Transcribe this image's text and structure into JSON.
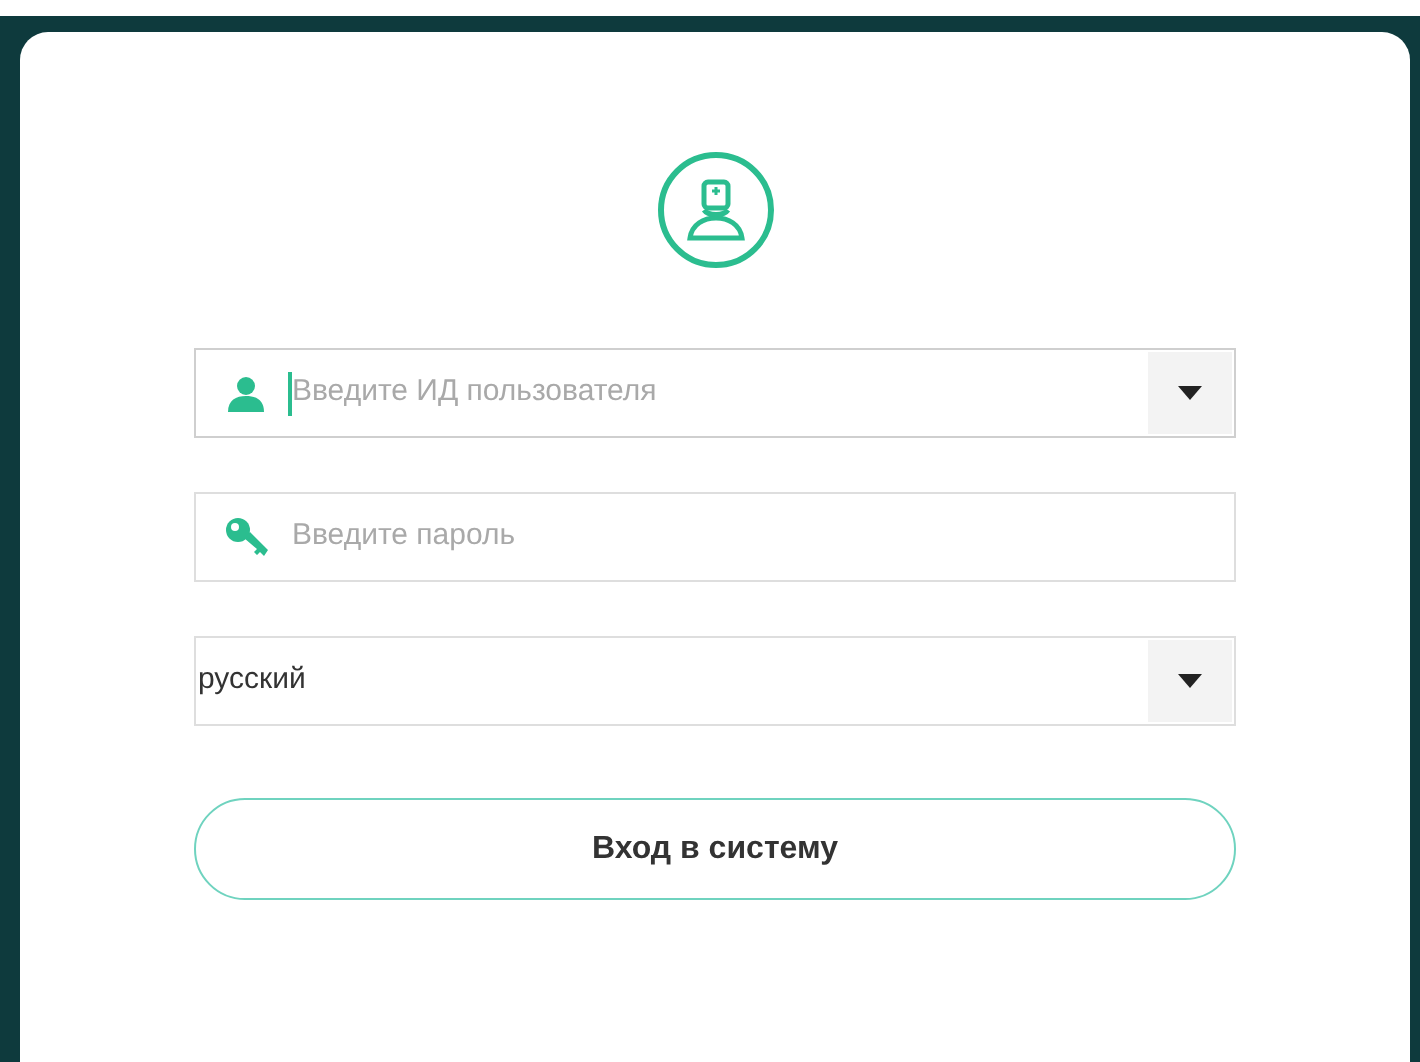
{
  "fields": [
    {
      "kind": "user",
      "placeholder": "Введите ИД пользователя",
      "focused": true,
      "dropdown": true
    },
    {
      "kind": "password",
      "placeholder": "Введите пароль",
      "focused": false,
      "dropdown": false
    }
  ],
  "language": {
    "value": "русский"
  },
  "login_button": {
    "label": "Вход в систему"
  }
}
